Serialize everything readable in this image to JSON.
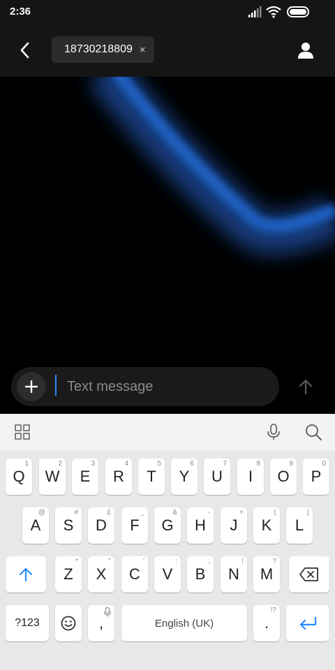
{
  "status": {
    "time": "2:36"
  },
  "header": {
    "recipient": "18730218809",
    "remove_symbol": "×"
  },
  "composer": {
    "placeholder": "Text message"
  },
  "keyboard": {
    "row1": [
      {
        "key": "Q",
        "hint": "1"
      },
      {
        "key": "W",
        "hint": "2"
      },
      {
        "key": "E",
        "hint": "3"
      },
      {
        "key": "R",
        "hint": "4"
      },
      {
        "key": "T",
        "hint": "5"
      },
      {
        "key": "Y",
        "hint": "6"
      },
      {
        "key": "U",
        "hint": "7"
      },
      {
        "key": "I",
        "hint": "8"
      },
      {
        "key": "O",
        "hint": "9"
      },
      {
        "key": "P",
        "hint": "0"
      }
    ],
    "row2": [
      {
        "key": "A",
        "hint": "@"
      },
      {
        "key": "S",
        "hint": "#"
      },
      {
        "key": "D",
        "hint": "£"
      },
      {
        "key": "F",
        "hint": "_"
      },
      {
        "key": "G",
        "hint": "&"
      },
      {
        "key": "H",
        "hint": "-"
      },
      {
        "key": "J",
        "hint": "+"
      },
      {
        "key": "K",
        "hint": "("
      },
      {
        "key": "L",
        "hint": ")"
      }
    ],
    "row3": [
      {
        "key": "Z",
        "hint": "*"
      },
      {
        "key": "X",
        "hint": "°"
      },
      {
        "key": "C",
        "hint": "'"
      },
      {
        "key": "V",
        "hint": ":"
      },
      {
        "key": "B",
        "hint": ";"
      },
      {
        "key": "N",
        "hint": "!"
      },
      {
        "key": "M",
        "hint": "?"
      }
    ],
    "symbols_label": "?123",
    "comma": ",",
    "space_label": "English (UK)",
    "period": ".",
    "period_hint": "!?"
  },
  "colors": {
    "accent": "#2b8cff",
    "wallpaper_glow": "#1f5fbf"
  }
}
